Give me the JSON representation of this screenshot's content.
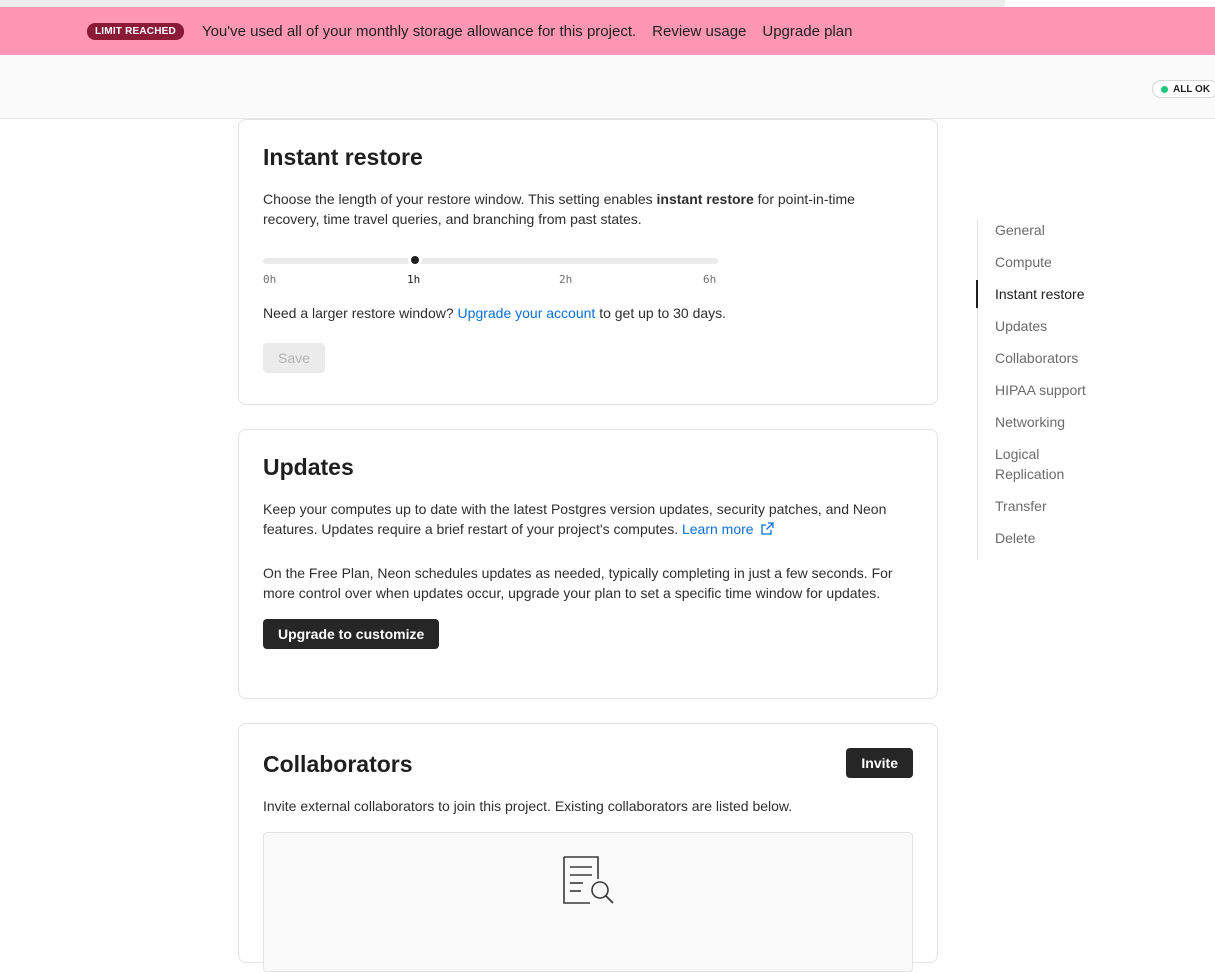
{
  "banner": {
    "badge": "LIMIT REACHED",
    "message": "You've used all of your monthly storage allowance for this project.",
    "review_usage": "Review usage",
    "upgrade_plan": "Upgrade plan"
  },
  "status": {
    "label": "ALL OK"
  },
  "instant_restore": {
    "title": "Instant restore",
    "desc_before": "Choose the length of your restore window. This setting enables ",
    "desc_bold": "instant restore",
    "desc_after": " for point-in-time recovery, time travel queries, and branching from past states.",
    "slider": {
      "selected": "1h",
      "ticks": [
        "0h",
        "1h",
        "2h",
        "6h"
      ]
    },
    "need_before": "Need a larger restore window? ",
    "need_link": "Upgrade your account",
    "need_after": " to get up to 30 days.",
    "save_label": "Save"
  },
  "updates": {
    "title": "Updates",
    "desc1": "Keep your computes up to date with the latest Postgres version updates, security patches, and Neon features. Updates require a brief restart of your project's computes. ",
    "learn_more": "Learn more",
    "desc2": "On the Free Plan, Neon schedules updates as needed, typically completing in just a few seconds. For more control over when updates occur, upgrade your plan to set a specific time window for updates.",
    "button": "Upgrade to customize"
  },
  "collaborators": {
    "title": "Collaborators",
    "invite": "Invite",
    "desc": "Invite external collaborators to join this project. Existing collaborators are listed below."
  },
  "toc": {
    "items": [
      "General",
      "Compute",
      "Instant restore",
      "Updates",
      "Collaborators",
      "HIPAA support",
      "Networking",
      "Logical Replication",
      "Transfer",
      "Delete"
    ],
    "active": "Instant restore"
  },
  "colors": {
    "banner_bg": "#ff97b4",
    "badge_bg": "#8a1a36",
    "link": "#0a6fd8",
    "status_ok": "#1bc77e"
  },
  "icons": [
    "external-link-icon",
    "document-search-icon",
    "status-dot-icon"
  ]
}
